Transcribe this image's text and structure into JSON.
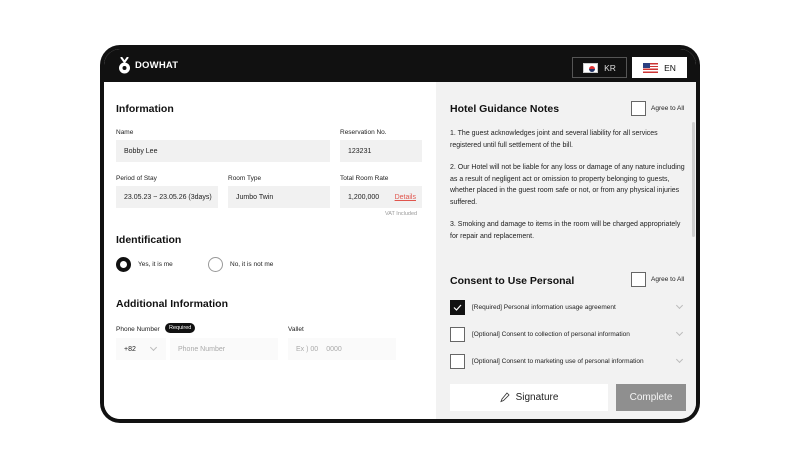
{
  "brand": {
    "name": "DOWHAT"
  },
  "languages": [
    {
      "code": "KR",
      "flag": "flag-kr-icon",
      "selected": false
    },
    {
      "code": "EN",
      "flag": "flag-us-icon",
      "selected": true
    }
  ],
  "information": {
    "title": "Information",
    "name_label": "Name",
    "name_value": "Bobby Lee",
    "reservation_label": "Reservation No.",
    "reservation_value": "123231",
    "period_label": "Period of Stay",
    "period_value": "23.05.23 ~ 23.05.26 (3days)",
    "room_type_label": "Room Type",
    "room_type_value": "Jumbo Twin",
    "rate_label": "Total Room Rate",
    "rate_value": "1,200,000",
    "details_link": "Details",
    "vat_note": "VAT Included"
  },
  "identification": {
    "title": "Identification",
    "options": [
      {
        "label": "Yes, it is me",
        "selected": true
      },
      {
        "label": "No, it is not me",
        "selected": false
      }
    ]
  },
  "additional": {
    "title": "Additional Information",
    "phone_label": "Phone Number",
    "required_badge": "Required",
    "country_code": "+82",
    "phone_placeholder": "Phone Number",
    "vallet_label": "Vallet",
    "vallet_placeholder_prefix": "Ex ) 00",
    "vallet_placeholder_num": "0000"
  },
  "guidance": {
    "title": "Hotel Guidance Notes",
    "agree_all": "Agree to All",
    "notes": [
      "1. The guest acknowledges joint and several liability for all services registered until full settlement of the bill.",
      "2. Our Hotel will not be liable for any loss or damage of any nature including as a result of negligent act or omission to property belonging to guests, whether placed in the guest room safe or not, or from any physical injuries suffered.",
      "3. Smoking and damage to items in the room will be charged appropriately for repair and replacement."
    ]
  },
  "consent": {
    "title": "Consent to Use Personal",
    "agree_all": "Agree to All",
    "items": [
      {
        "label": "[Required] Personal information usage agreement",
        "checked": true
      },
      {
        "label": "[Optional] Consent to collection of personal information",
        "checked": false
      },
      {
        "label": "[Optional] Consent to marketing use of personal information",
        "checked": false
      }
    ]
  },
  "actions": {
    "signature": "Signature",
    "complete": "Complete"
  }
}
